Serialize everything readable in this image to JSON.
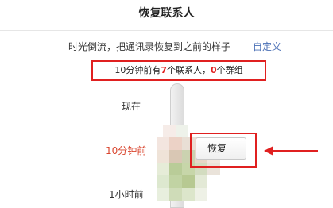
{
  "header": {
    "title": "恢复联系人"
  },
  "intro": {
    "text": "时光倒流，把通讯录恢复到之前的样子",
    "link": "自定义"
  },
  "summary": {
    "prefix": "10分钟前有",
    "contacts_count": "7",
    "contacts_unit": "个联系人，",
    "groups_count": "0",
    "groups_unit": "个群组"
  },
  "timeline": {
    "label_now": "现在",
    "label_10min": "10分钟前",
    "label_1h": "1小时前"
  },
  "actions": {
    "restore_label": "恢复"
  },
  "colors": {
    "accent_red": "#e02020",
    "link_blue": "#4a6fb5",
    "time_red": "#d9442d"
  }
}
